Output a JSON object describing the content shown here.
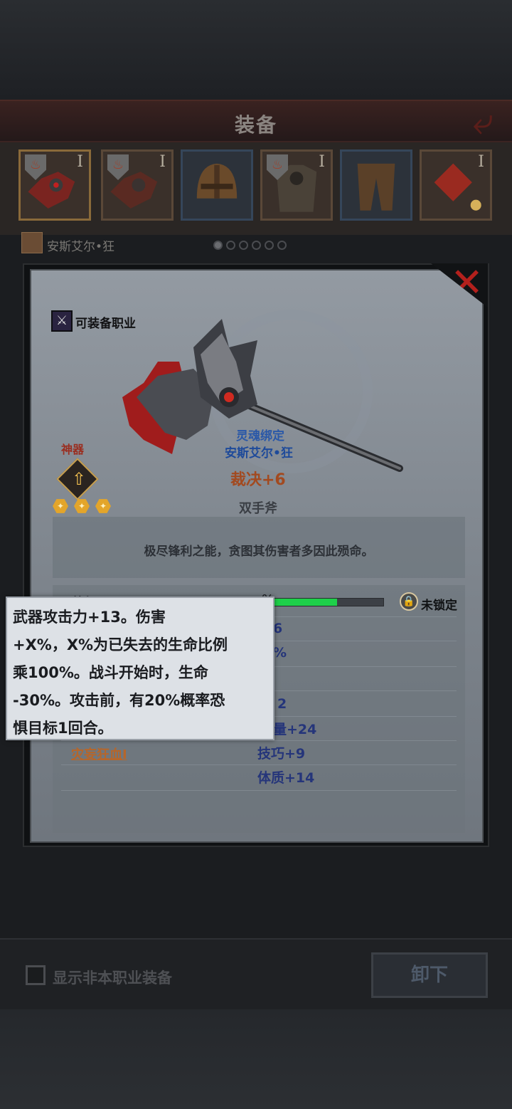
{
  "header": {
    "title": "装备"
  },
  "equipment_slots": [
    {
      "roman": "I",
      "has_emblem": true
    },
    {
      "roman": "I",
      "has_emblem": true
    },
    {
      "roman": "",
      "has_emblem": false
    },
    {
      "roman": "I",
      "has_emblem": true
    },
    {
      "roman": "",
      "has_emblem": false
    },
    {
      "roman": "I",
      "has_emblem": false
    }
  ],
  "character": {
    "name": "安斯艾尔•狂",
    "page_dots": 6,
    "active_dot": 0
  },
  "item": {
    "job_label": "可装备职业",
    "artifact_label": "神器",
    "stars": 3,
    "bound_label": "灵魂绑定",
    "bound_owner": "安斯艾尔•狂",
    "name": "裁决+6",
    "type": "双手斧",
    "description": "极尽锋利之能，贪图其伤害者多因此殒命。",
    "level_label": "等级",
    "xp_percent": 0.8,
    "xp_percent_text": "%",
    "lock_label": "未锁定",
    "stats_visible": [
      "6",
      "%",
      "2",
      "量+24",
      "技巧+9",
      "体质+14"
    ],
    "skill": "灾妄狂血I"
  },
  "tooltip": {
    "lines": [
      "武器攻击力+13。伤害",
      "+X%，X%为已失去的生命比例",
      "乘100%。战斗开始时，生命",
      "-30%。攻击前，有20%概率恐",
      "惧目标1回合。"
    ]
  },
  "bottom": {
    "show_other_label": "显示非本职业装备",
    "unequip_label": "卸下"
  },
  "colors": {
    "xp_fill": "#1ed04a",
    "close": "#b3201c",
    "stat_text": "#25357a"
  }
}
